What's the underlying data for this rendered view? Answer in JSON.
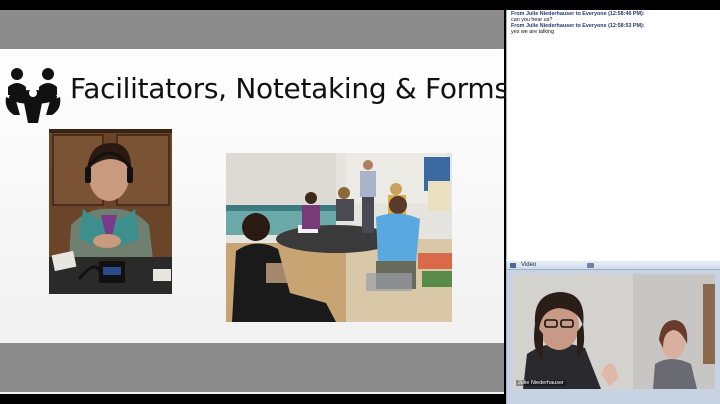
{
  "slide": {
    "title": "Facilitators, Notetaking & Forms"
  },
  "chat": {
    "messages": [
      {
        "from": "From Julie Niederhauser to Everyone (12:58:46 PM):",
        "text": "can you hear us?"
      },
      {
        "from": "From Julie Niederhauser to Everyone (12:58:53 PM):",
        "text": "yes we are talking"
      }
    ]
  },
  "video": {
    "label": "Video",
    "presenter": "Julie Niederhauser"
  },
  "icons": {
    "logo": "people-at-table-icon",
    "video_header": "video-pane-icon",
    "camera": "camera-icon"
  },
  "colors": {
    "slide_band": "#8c8c8c",
    "chat_from": "#1d3b78",
    "video_pane": "#c7d3e3"
  }
}
